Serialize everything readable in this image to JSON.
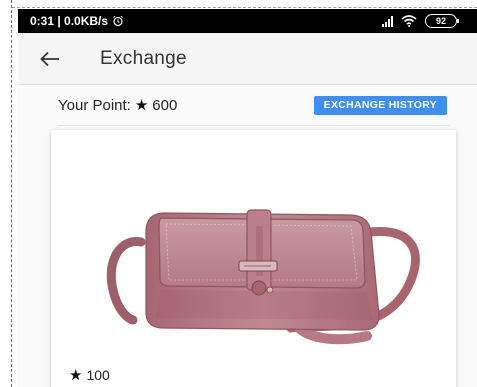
{
  "status_bar": {
    "time_speed": "0:31 | 0.0KB/s",
    "alarm_icon": "alarm-icon",
    "battery": "92"
  },
  "app_bar": {
    "back_icon": "arrow-left-icon",
    "title": "Exchange"
  },
  "points": {
    "label": "Your Point:",
    "star_icon": "star-icon",
    "value": "600"
  },
  "history_button": {
    "label": "EXCHANGE HISTORY"
  },
  "product": {
    "image": "pink-crossbody-handbag",
    "price_star_icon": "star-icon",
    "price": "100"
  },
  "colors": {
    "accent": "#3f8ef1",
    "bag": "#b77983",
    "status_bar": "#000000"
  }
}
